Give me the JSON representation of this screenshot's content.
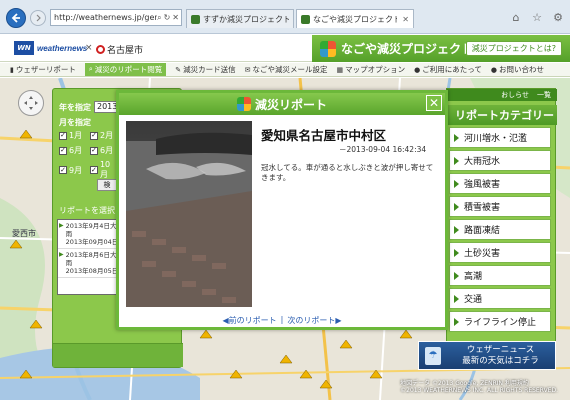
{
  "browser": {
    "url": "http://weathernews.jp/gens",
    "url_icons": [
      "search-icon",
      "refresh-icon",
      "close-icon"
    ],
    "tabs": [
      {
        "label": "すずか減災プロジェクト - ウェザー...",
        "active": false
      },
      {
        "label": "なごや減災プロジェクト - ウェザ...",
        "active": true
      }
    ],
    "chrome_icons": [
      "home-icon",
      "star-icon",
      "gear-icon"
    ]
  },
  "site": {
    "logo_text": "weathernews",
    "city": "名古屋市",
    "project_title": "なごや減災プロジェクト",
    "about_button": "減災プロジェクトとは?"
  },
  "nav": {
    "items": [
      {
        "label": "ウェザーリポート",
        "icon": "bookmark-icon",
        "active": false
      },
      {
        "label": "減災のリポート閲覧",
        "icon": "search-icon",
        "active": true
      },
      {
        "label": "減災カード送信",
        "icon": "pencil-icon",
        "active": false
      },
      {
        "label": "なごや減災メール設定",
        "icon": "mail-icon",
        "active": false
      },
      {
        "label": "マップオプション",
        "icon": "map-icon",
        "active": false
      },
      {
        "label": "ご利用にあたって",
        "icon": "info-icon",
        "active": false
      },
      {
        "label": "お問い合わせ",
        "icon": "info-icon",
        "active": false
      }
    ]
  },
  "filter": {
    "year_label": "年を指定",
    "year_value": "2013年",
    "month_label": "月を指定",
    "months": [
      {
        "label": "1月",
        "checked": true
      },
      {
        "label": "2月",
        "checked": true
      },
      {
        "label": "6月",
        "checked": true
      },
      {
        "label": "6月",
        "checked": true
      },
      {
        "label": "9月",
        "checked": true
      },
      {
        "label": "10月",
        "checked": true
      }
    ],
    "search_button": "検",
    "report_select_label": "リポートを選択",
    "reports": [
      {
        "line1": "2013年9月4日大雨",
        "line2": "2013年09月04日"
      },
      {
        "line1": "2013年8月6日大雨",
        "line2": "2013年08月05日"
      }
    ]
  },
  "map": {
    "labels": [
      "愛西市"
    ],
    "copyright_line1": "地図データ ©2013 Google, ZENRIN 利用規約",
    "copyright_line2": "©2013 WEATHERNEWS INC. ALL RIGHTS RESERVED."
  },
  "categories": {
    "top_links": [
      "おしらせ",
      "一覧"
    ],
    "header": "リポートカテゴリー",
    "items": [
      "河川増水・氾濫",
      "大雨冠水",
      "強風被害",
      "積雪被害",
      "路面凍結",
      "土砂災害",
      "高潮",
      "交通",
      "ライフライン停止"
    ]
  },
  "banner": {
    "line1": "ウェザーニュース",
    "line2": "最新の天気はコチラ"
  },
  "modal": {
    "title": "減災リポート",
    "close_label": "✕",
    "location": "愛知県名古屋市中村区",
    "datetime": "－2013-09-04 16:42:34",
    "text": "冠水してる。車が通ると水しぶきと波が押し寄せてきます。",
    "prev_label": "◀前のリポート",
    "separator": "|",
    "next_label": "次のリポート▶"
  },
  "colors": {
    "brand_green": "#6cb83a",
    "dark_green": "#3f8a1d",
    "wn_blue": "#1d4ea3"
  }
}
